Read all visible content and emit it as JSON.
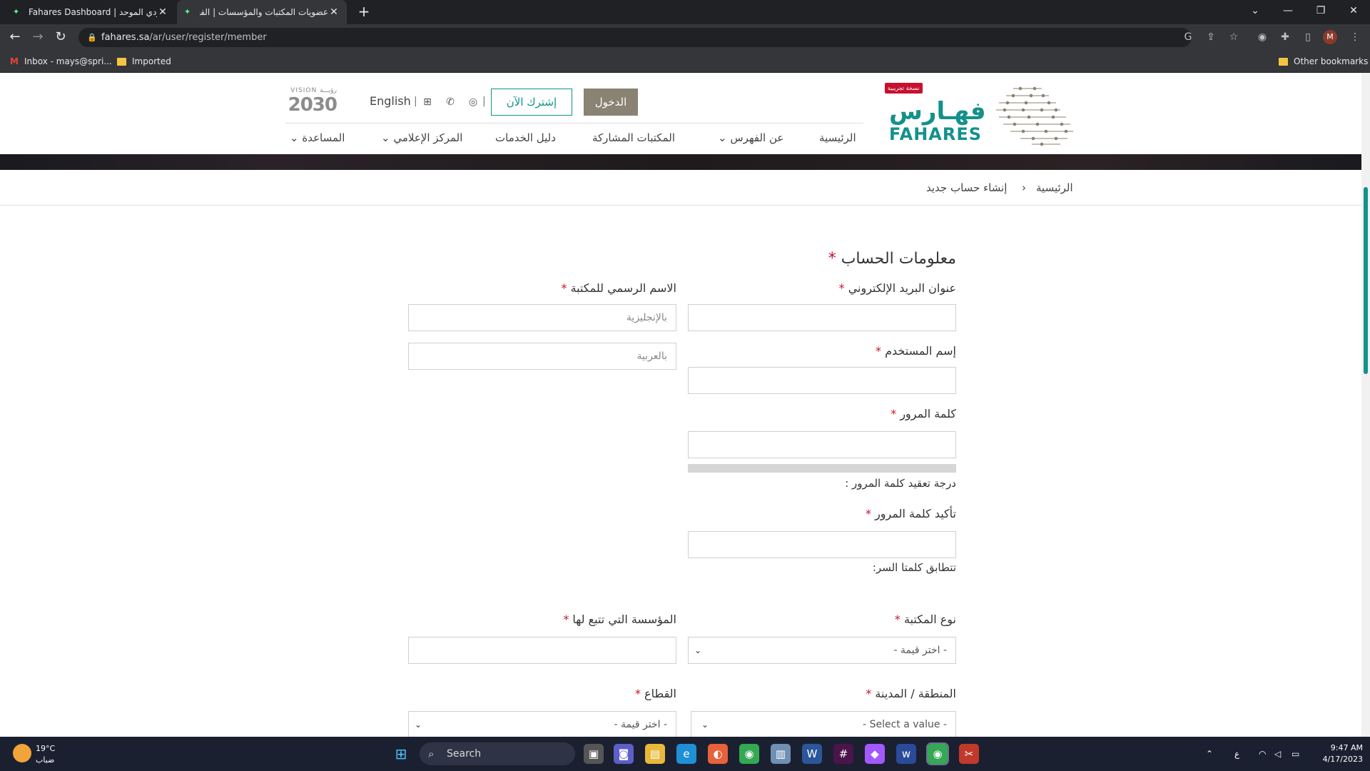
{
  "browser": {
    "tabs": [
      {
        "label": "Fahares Dashboard | الفهرس العربي السعودي الموحد",
        "active": false
      },
      {
        "label": "عضويات المكتبات والمؤسسات | الفهرس",
        "active": true
      }
    ],
    "url_host": "fahares.sa",
    "url_path": "/ar/user/register/member",
    "profile_initial": "M",
    "bookmarks": [
      {
        "label": "Inbox - mays@spri..."
      },
      {
        "label": "Imported"
      }
    ],
    "other_bookmarks": "Other bookmarks"
  },
  "site": {
    "beta_badge": "نسخة تجريبية",
    "logo_ar": "فهـارس",
    "logo_en": "FAHARES",
    "login_label": "الدخول",
    "subscribe_label": "إشترك الآن",
    "language_link": "English",
    "vision_top": "VISION رؤيـــة",
    "vision_year": "2030",
    "nav": {
      "home": "الرئيسية",
      "about": "عن الفهرس",
      "libraries": "المكتبات المشاركة",
      "services": "دليل الخدمات",
      "media": "المركز الإعلامي",
      "help": "المساعدة"
    }
  },
  "breadcrumb": {
    "home": "الرئيسية",
    "current": "إنشاء حساب جديد"
  },
  "form": {
    "section_title": "معلومات الحساب",
    "email_label": "عنوان البريد الإلكتروني",
    "official_name_label": "الاسم الرسمي للمكتبة",
    "name_en_placeholder": "بالإنجليزية",
    "name_ar_placeholder": "بالعربية",
    "username_label": "إسم المستخدم",
    "password_label": "كلمة المرور",
    "strength_label": "درجة تعقيد كلمة المرور :",
    "confirm_label": "تأكيد كلمة المرور",
    "match_label": "تتطابق كلمتا السر:",
    "library_type_label": "نوع المكتبة",
    "library_type_value": "- اختر قيمة -",
    "institution_label": "المؤسسة التي تتبع لها",
    "region_label": "المنطقة / المدينة",
    "region_value": "- Select a value -",
    "sector_label": "القطاع",
    "sector_value": "- اختر قيمة -",
    "required_mark": "*"
  },
  "taskbar": {
    "weather_temp": "19°C",
    "weather_desc": "ضباب",
    "search_label": "Search",
    "lang_indicator": "ع",
    "time": "9:47 AM",
    "date": "4/17/2023"
  },
  "colors": {
    "brand_teal": "#13918a",
    "login_bg": "#8a8272",
    "required_red": "#c8102e"
  }
}
